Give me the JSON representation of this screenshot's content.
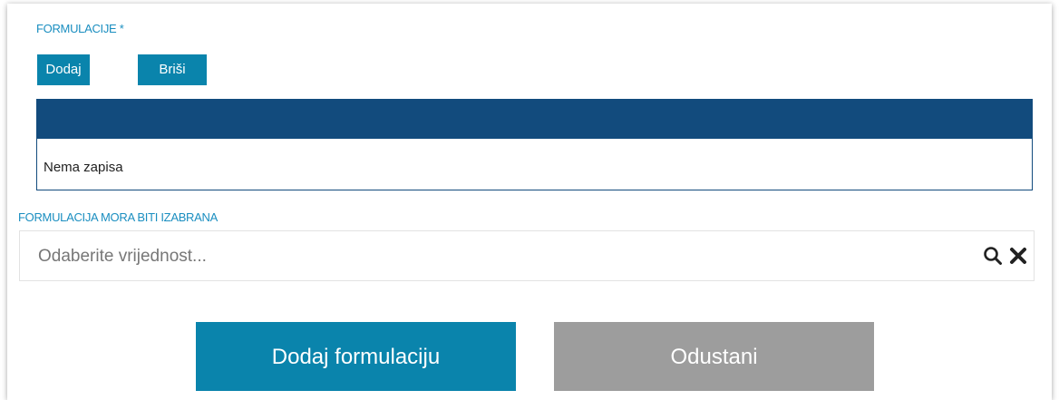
{
  "formulacije": {
    "label": "FORMULACIJE *",
    "add_label": "Dodaj",
    "delete_label": "Briši"
  },
  "grid": {
    "empty_text": "Nema zapisa"
  },
  "validation": {
    "message": "FORMULACIJA MORA BITI IZABRANA"
  },
  "select": {
    "placeholder": "Odaberite vrijednost...",
    "search_icon": "search-icon",
    "clear_icon": "close-icon"
  },
  "actions": {
    "submit_label": "Dodaj formulaciju",
    "cancel_label": "Odustani"
  },
  "colors": {
    "accent": "#0a84ac",
    "header": "#124b7d",
    "label": "#1a8ec0",
    "cancel": "#9d9d9d"
  }
}
